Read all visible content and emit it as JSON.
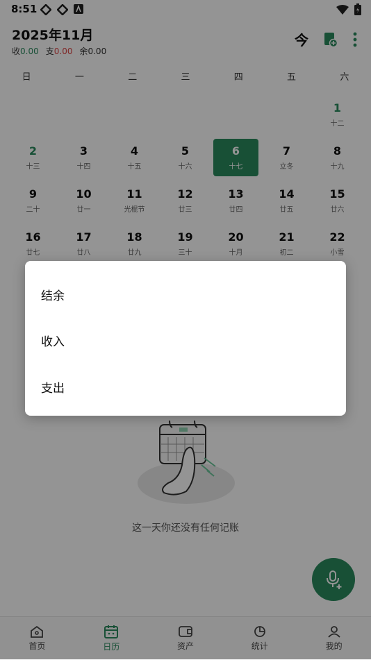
{
  "status": {
    "time": "8:51"
  },
  "header": {
    "title": "2025年11月",
    "income_label": "收",
    "income_value": "0.00",
    "expense_label": "支",
    "expense_value": "0.00",
    "balance_label": "余",
    "balance_value": "0.00",
    "today_label": "今"
  },
  "weekdays": [
    "日",
    "一",
    "二",
    "三",
    "四",
    "五",
    "六"
  ],
  "days": [
    {
      "num": "1",
      "lunar": "十二"
    },
    {
      "num": "2",
      "lunar": "十三"
    },
    {
      "num": "3",
      "lunar": "十四"
    },
    {
      "num": "4",
      "lunar": "十五"
    },
    {
      "num": "5",
      "lunar": "十六"
    },
    {
      "num": "6",
      "lunar": "十七"
    },
    {
      "num": "7",
      "lunar": "立冬"
    },
    {
      "num": "8",
      "lunar": "十九"
    },
    {
      "num": "9",
      "lunar": "二十"
    },
    {
      "num": "10",
      "lunar": "廿一"
    },
    {
      "num": "11",
      "lunar": "光棍节"
    },
    {
      "num": "12",
      "lunar": "廿三"
    },
    {
      "num": "13",
      "lunar": "廿四"
    },
    {
      "num": "14",
      "lunar": "廿五"
    },
    {
      "num": "15",
      "lunar": "廿六"
    },
    {
      "num": "16",
      "lunar": "廿七"
    },
    {
      "num": "17",
      "lunar": "廿八"
    },
    {
      "num": "18",
      "lunar": "廿九"
    },
    {
      "num": "19",
      "lunar": "三十"
    },
    {
      "num": "20",
      "lunar": "十月"
    },
    {
      "num": "21",
      "lunar": "初二"
    },
    {
      "num": "22",
      "lunar": "小雪"
    }
  ],
  "empty_text": "这一天你还没有任何记账",
  "nav": [
    "首页",
    "日历",
    "资产",
    "统计",
    "我的"
  ],
  "dialog": {
    "options": [
      "结余",
      "收入",
      "支出"
    ]
  },
  "colors": {
    "accent": "#2a8a5e",
    "expense": "#dd4444"
  }
}
